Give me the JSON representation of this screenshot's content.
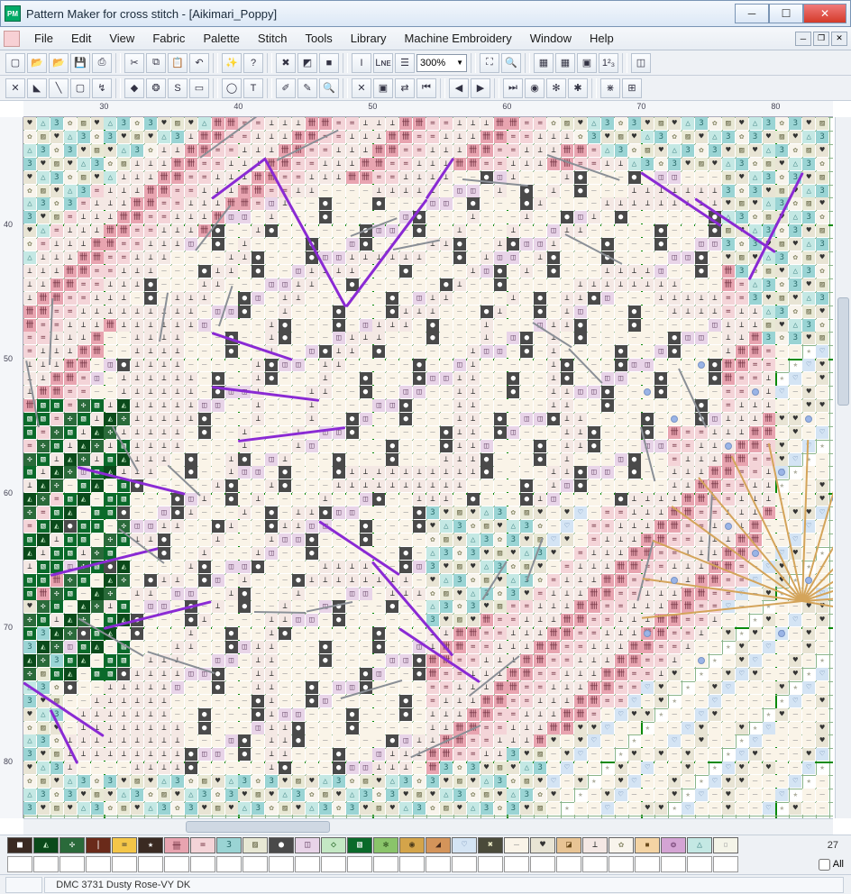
{
  "window": {
    "title": "Pattern Maker for cross stitch - [Aikimari_Poppy]",
    "app_badge": "PM"
  },
  "menu": {
    "items": [
      "File",
      "Edit",
      "View",
      "Fabric",
      "Palette",
      "Stitch",
      "Tools",
      "Library",
      "Machine Embroidery",
      "Window",
      "Help"
    ]
  },
  "toolbar1_icons": [
    "new",
    "open",
    "open2",
    "save",
    "print",
    "cut",
    "copy",
    "paste",
    "undo",
    "wizard",
    "help",
    "toggle-x",
    "toggle-square",
    "color-fill",
    "italic",
    "line",
    "text-tool",
    "zoom-dropdown",
    "fit-all",
    "zoom-sel",
    "grid",
    "bold-grid",
    "colors",
    "count",
    "more"
  ],
  "zoom": "300%",
  "toolbar2_icons": [
    "full-x",
    "half",
    "quarter",
    "back",
    "special",
    "bead",
    "motif",
    "s-stitch",
    "select-rect",
    "select-ellipse",
    "text",
    "erase",
    "eyedrop",
    "zoom",
    "cross-del",
    "sel-move",
    "swap",
    "first",
    "prev",
    "next",
    "last",
    "s1",
    "s2",
    "s3",
    "s4",
    "s5"
  ],
  "ruler_h": [
    30,
    40,
    50,
    60,
    70,
    80
  ],
  "ruler_v": [
    40,
    50,
    60,
    70,
    80
  ],
  "palette_row": [
    {
      "bg": "#3a2a22",
      "fg": "#fff",
      "ch": "■"
    },
    {
      "bg": "#0a4a1a",
      "fg": "#c4e8c4",
      "ch": "◭"
    },
    {
      "bg": "#2a6a3a",
      "fg": "#fff",
      "ch": "✣"
    },
    {
      "bg": "#6a2a1a",
      "fg": "#fff",
      "ch": "|"
    },
    {
      "bg": "#f4c648",
      "fg": "#333",
      "ch": "="
    },
    {
      "bg": "#3a2a22",
      "fg": "#fff",
      "ch": "★"
    },
    {
      "bg": "#e8a4b0",
      "fg": "#6a2a3a",
      "ch": "卌"
    },
    {
      "bg": "#f4d4d8",
      "fg": "#6a2a3a",
      "ch": "="
    },
    {
      "bg": "#9ad4d4",
      "fg": "#2a6a6a",
      "ch": "3"
    },
    {
      "bg": "#e8e8d4",
      "fg": "#6a6a4a",
      "ch": "▨"
    },
    {
      "bg": "#4a4a4a",
      "fg": "#fff",
      "ch": "●"
    },
    {
      "bg": "#e8d4e8",
      "fg": "#6a4a6a",
      "ch": "◫"
    },
    {
      "bg": "#c4e8c4",
      "fg": "#2a6a2a",
      "ch": "◇"
    },
    {
      "bg": "#0a6a2a",
      "fg": "#fff",
      "ch": "▧"
    },
    {
      "bg": "#8ac46a",
      "fg": "#2a4a1a",
      "ch": "✻"
    },
    {
      "bg": "#d4a44a",
      "fg": "#4a3a1a",
      "ch": "◉"
    },
    {
      "bg": "#d4945a",
      "fg": "#4a2a1a",
      "ch": "◢"
    },
    {
      "bg": "#d4e4f4",
      "fg": "#5a7aa4",
      "ch": "♡"
    },
    {
      "bg": "#4a4a3a",
      "fg": "#e8e8c4",
      "ch": "✖"
    },
    {
      "bg": "#faf4e8",
      "fg": "#999",
      "ch": "–"
    },
    {
      "bg": "#e8e4d4",
      "fg": "#333",
      "ch": "♥"
    },
    {
      "bg": "#e8c494",
      "fg": "#6a4a1a",
      "ch": "◪"
    },
    {
      "bg": "#f4e8e4",
      "fg": "#333",
      "ch": "⊥"
    },
    {
      "bg": "#f8f4ec",
      "fg": "#8a8a6a",
      "ch": "✿"
    },
    {
      "bg": "#f4d4a4",
      "fg": "#6a4a1a",
      "ch": "▪"
    },
    {
      "bg": "#d4a4d4",
      "fg": "#6a3a6a",
      "ch": "❂"
    },
    {
      "bg": "#c4e8e4",
      "fg": "#4a8a8a",
      "ch": "△"
    },
    {
      "bg": "#f4f4e8",
      "fg": "#aaa",
      "ch": "▫"
    }
  ],
  "palette_count": "27",
  "all_label": "All",
  "status": {
    "dmc": "DMC  3731  Dusty Rose-VY DK"
  },
  "chart_data": {
    "type": "cross-stitch-grid",
    "viewport_cols": [
      24,
      84
    ],
    "viewport_rows": [
      32,
      84
    ],
    "grid_major_every": 10,
    "backstitches_purple": [
      [
        38,
        38,
        42,
        35
      ],
      [
        42,
        35,
        48,
        46
      ],
      [
        48,
        46,
        54,
        38
      ],
      [
        54,
        38,
        56,
        35
      ],
      [
        38,
        48,
        44,
        50
      ],
      [
        38,
        52,
        46,
        53
      ],
      [
        40,
        56,
        48,
        55
      ],
      [
        28,
        58,
        36,
        60
      ],
      [
        26,
        66,
        34,
        64
      ],
      [
        30,
        70,
        38,
        68
      ],
      [
        46,
        62,
        52,
        66
      ],
      [
        50,
        65,
        56,
        72
      ],
      [
        52,
        70,
        58,
        74
      ],
      [
        70,
        36,
        76,
        40
      ],
      [
        74,
        38,
        80,
        42
      ],
      [
        78,
        44,
        82,
        36
      ],
      [
        24,
        74,
        30,
        78
      ],
      [
        26,
        76,
        28,
        80
      ]
    ],
    "outline_grey_segments": 42,
    "bead_points": [
      [
        70,
        52
      ],
      [
        72,
        54
      ],
      [
        74,
        50
      ],
      [
        76,
        56
      ],
      [
        78,
        52
      ],
      [
        80,
        58
      ],
      [
        82,
        54
      ],
      [
        84,
        60
      ],
      [
        76,
        62
      ],
      [
        78,
        64
      ],
      [
        72,
        66
      ],
      [
        70,
        70
      ],
      [
        74,
        72
      ],
      [
        80,
        70
      ],
      [
        82,
        66
      ]
    ]
  }
}
